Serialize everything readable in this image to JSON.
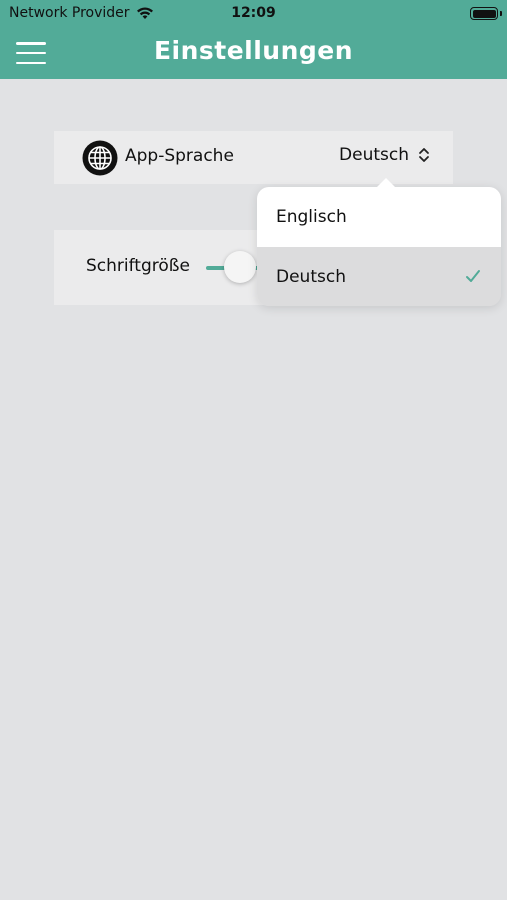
{
  "status_bar": {
    "provider": "Network Provider",
    "time": "12:09",
    "wifi_icon": "wifi-icon",
    "battery_icon": "battery-icon"
  },
  "nav": {
    "title": "Einstellungen",
    "menu_icon": "hamburger-menu-icon"
  },
  "language_setting": {
    "icon": "globe-icon",
    "label": "App-Sprache",
    "value": "Deutsch",
    "selector_icon": "chevron-up-down-icon"
  },
  "font_size_setting": {
    "label": "Schriftgröße",
    "slider_level": 0.15
  },
  "language_menu": {
    "options": [
      {
        "label": "Englisch",
        "selected": false
      },
      {
        "label": "Deutsch",
        "selected": true
      }
    ],
    "check_icon": "checkmark-icon"
  },
  "colors": {
    "accent": "#52ab98",
    "background": "#e1e2e4",
    "card": "#ebebec"
  }
}
